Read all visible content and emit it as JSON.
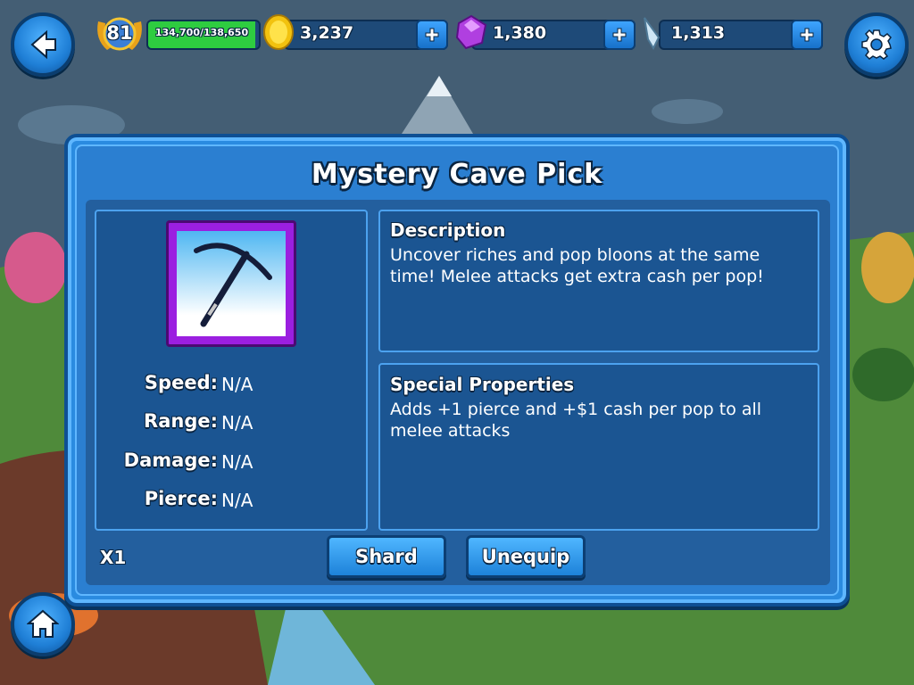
{
  "hud": {
    "level": "81",
    "xp": "134,700/138,650",
    "xp_progress": 0.97,
    "coins": "3,237",
    "gems": "1,380",
    "shards": "1,313"
  },
  "dialog": {
    "title": "Mystery Cave Pick",
    "item_icon": "pickaxe-icon",
    "stats": [
      {
        "label": "Speed:",
        "value": "N/A"
      },
      {
        "label": "Range:",
        "value": "N/A"
      },
      {
        "label": "Damage:",
        "value": "N/A"
      },
      {
        "label": "Pierce:",
        "value": "N/A"
      }
    ],
    "description": {
      "heading": "Description",
      "text": "Uncover riches and pop bloons at the same time! Melee attacks get extra cash per pop!"
    },
    "special": {
      "heading": "Special Properties",
      "text": "Adds +1 pierce and +$1 cash per pop to all melee attacks"
    },
    "quantity": "X1",
    "shard_label": "Shard",
    "unequip_label": "Unequip"
  },
  "colors": {
    "panel": "#2a8be0",
    "xp_bar": "#2ecc40",
    "rarity_frame": "#9b1fe0"
  }
}
